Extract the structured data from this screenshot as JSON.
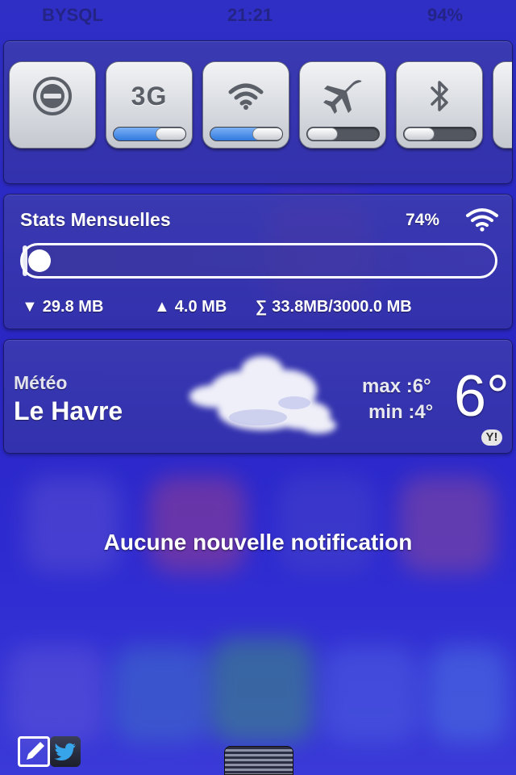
{
  "statusbar": {
    "carrier": "BYSQL",
    "time": "21:21",
    "battery": "94%"
  },
  "toggles": [
    {
      "name": "do-not-disturb",
      "icon": "minus-circle-icon",
      "on": false,
      "level": null
    },
    {
      "name": "3g",
      "label": "3G",
      "icon": "3g-icon",
      "on": true,
      "level": 1
    },
    {
      "name": "wifi",
      "icon": "wifi-icon",
      "on": true,
      "level": 1
    },
    {
      "name": "airplane",
      "icon": "airplane-icon",
      "on": false,
      "level": 0
    },
    {
      "name": "bluetooth",
      "icon": "bluetooth-icon",
      "on": false,
      "level": 0
    },
    {
      "name": "more",
      "icon": "",
      "on": false,
      "level": 0
    }
  ],
  "stats": {
    "title": "Stats Mensuelles",
    "percent": "74%",
    "usage_fraction": 0.011,
    "download": "29.8 MB",
    "upload": "4.0 MB",
    "total": "33.8MB/3000.0 MB",
    "download_symbol": "▼",
    "upload_symbol": "▲",
    "total_symbol": "∑"
  },
  "weather": {
    "label": "Météo",
    "city": "Le Havre",
    "max_text": "max :6°",
    "min_text": "min :4°",
    "temperature": "6°",
    "provider": "Y!"
  },
  "notifications": {
    "empty_text": "Aucune nouvelle notification"
  },
  "colors": {
    "background": "#2a22b8",
    "switch_on": "#2f79de"
  }
}
